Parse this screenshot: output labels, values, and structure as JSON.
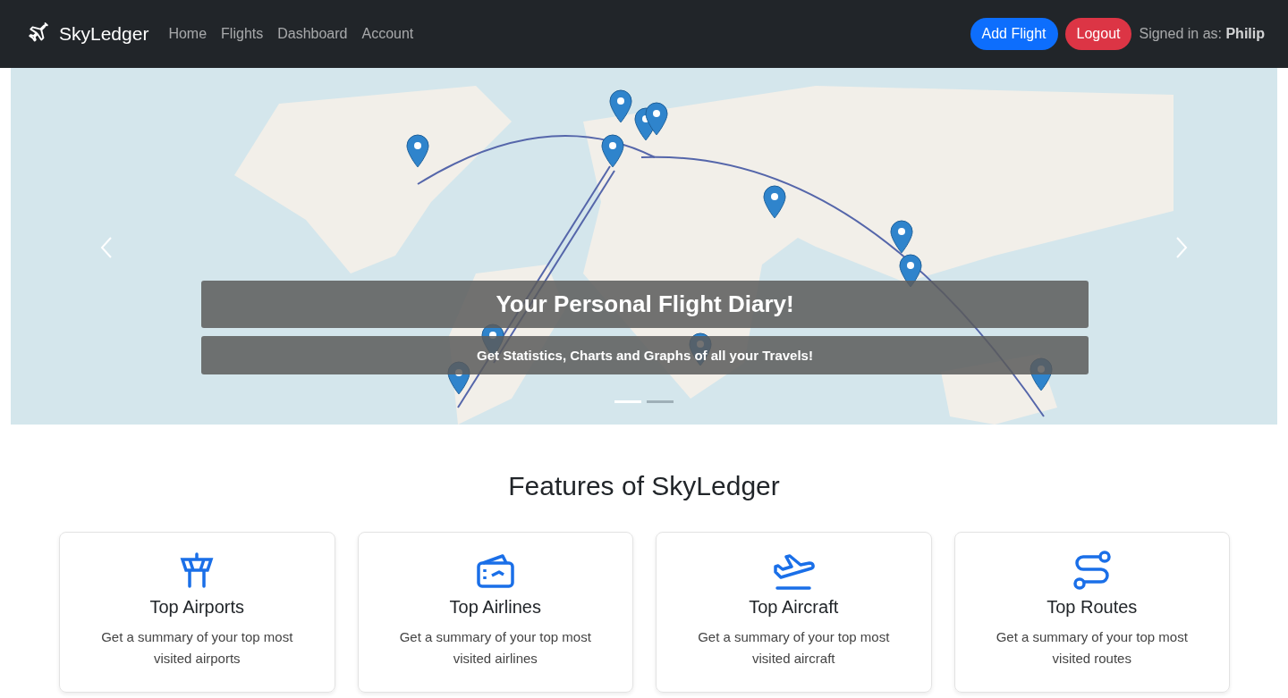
{
  "navbar": {
    "brand": "SkyLedger",
    "links": [
      {
        "label": "Home"
      },
      {
        "label": "Flights"
      },
      {
        "label": "Dashboard"
      },
      {
        "label": "Account"
      }
    ],
    "buttons": [
      {
        "label": "Add Flight",
        "kind": "primary"
      },
      {
        "label": "Logout",
        "kind": "danger"
      }
    ],
    "signed_in": "Signed in as: **Philip**"
  },
  "carousel": {
    "title": "Your Personal Flight Diary!",
    "subtitle": "Get Statistics, Charts and Graphs of all your Travels!",
    "indicators": [
      {
        "selected": true
      },
      {
        "selected": false
      }
    ]
  },
  "features": {
    "heading": "Features of SkyLedger",
    "cards": [
      {
        "title": "Top Airports",
        "text": "Get a summary of your top most visited airports"
      },
      {
        "title": "Top Airlines",
        "text": "Get a summary of your top most visited airlines"
      },
      {
        "title": "Top Aircraft",
        "text": "Get a summary of your top most visited aircraft"
      },
      {
        "title": "Top Routes",
        "text": "Get a summary of your top most visited routes"
      }
    ]
  }
}
